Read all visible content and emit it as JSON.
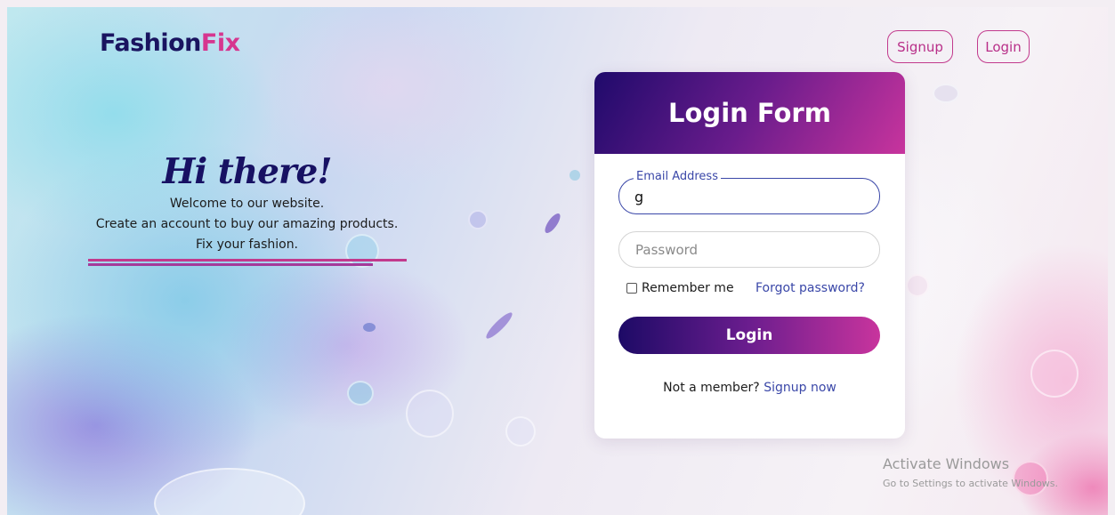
{
  "brand": {
    "part1": "Fashion",
    "part2": "Fix"
  },
  "nav": {
    "signup_label": "Signup",
    "login_label": "Login"
  },
  "hero": {
    "title": "Hi there!",
    "line1": "Welcome to our website.",
    "line2": "Create an account to buy our amazing products.",
    "line3": "Fix your fashion."
  },
  "login_form": {
    "title": "Login Form",
    "email_label": "Email Address",
    "email_value": "g",
    "password_placeholder": "Password",
    "remember_label": "Remember me",
    "remember_checked": false,
    "forgot_label": "Forgot password?",
    "submit_label": "Login",
    "not_member_text": "Not a member?",
    "signup_link": "Signup now"
  },
  "watermark": {
    "line1": "Activate Windows",
    "line2": "Go to Settings to activate Windows."
  },
  "colors": {
    "brand_dark": "#1a1460",
    "brand_pink": "#d6368f",
    "accent_blue": "#3a47a8",
    "gradient_start": "#1d0a66",
    "gradient_end": "#c8349d"
  }
}
